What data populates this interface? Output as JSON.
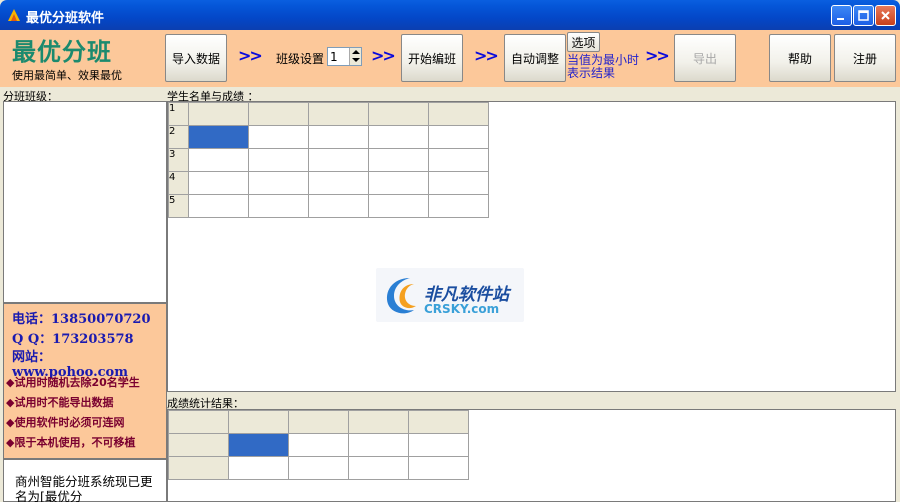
{
  "window": {
    "title": "最优分班软件"
  },
  "brand": {
    "name": "最优分班",
    "slogan": "使用最简单、效果最优"
  },
  "toolbar": {
    "import": "导入数据",
    "arrow": ">>",
    "class_setting_label": "班级设置",
    "class_count": "1",
    "start": "开始编班",
    "auto_adjust": "自动调整",
    "option": "选项",
    "hint": "当值为最小时表示结果",
    "export": "导出",
    "help": "帮助",
    "register": "注册"
  },
  "panels": {
    "class_list_label": "分班班级：",
    "students_label": "学生名单与成绩 ：",
    "stats_label": "成绩统计结果："
  },
  "contact": {
    "phone": "电话：13850070720",
    "qq": "Q Q：173203578",
    "website": "网站：www.pohoo.com"
  },
  "notices": [
    "◆试用时随机去除20名学生",
    "◆试用时不能导出数据",
    "◆使用软件时必须可连网",
    "◆限于本机使用，不可移植"
  ],
  "memo": "商州智能分班系统现已更名为[最优分",
  "grid": {
    "row_numbers": [
      "1",
      "2",
      "3",
      "4",
      "5"
    ]
  },
  "watermark": {
    "cn": "非凡软件站",
    "en": "CRSKY.com"
  },
  "colors": {
    "accent": "#fcc89a",
    "brand": "#1c8a6e",
    "selection": "#316ac5",
    "titlebar": "#0347c8"
  }
}
